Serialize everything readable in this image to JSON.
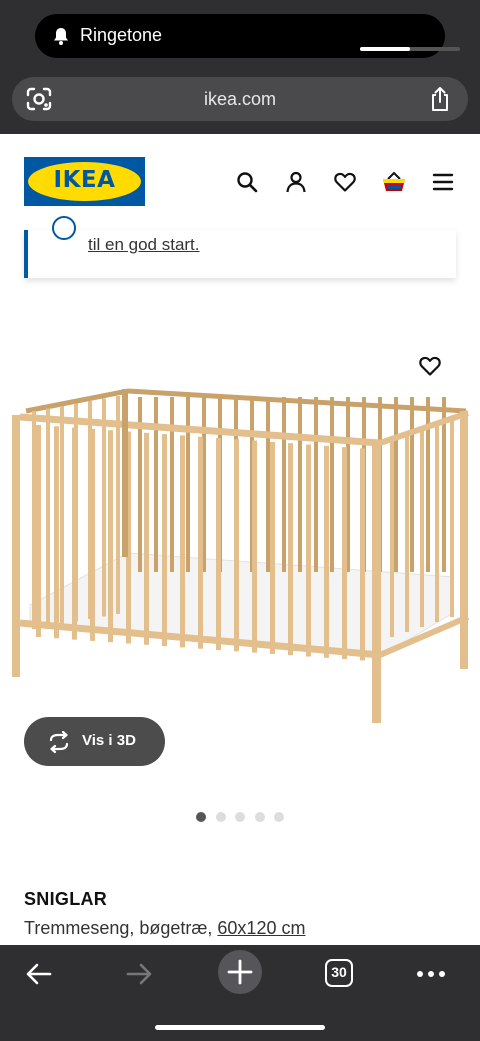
{
  "status": {
    "notification_label": "Ringetone",
    "volume_level": 0.5
  },
  "browser": {
    "url": "ikea.com",
    "tabs_count": "30"
  },
  "header": {
    "logo_text": "IKEA"
  },
  "promo": {
    "link_text": "til en god start."
  },
  "product": {
    "view_3d_label": "Vis i 3D",
    "name": "SNIGLAR",
    "description": "Tremmeseng, bøgetræ, ",
    "size": "60x120 cm",
    "carousel": {
      "total": 5,
      "active": 0
    }
  },
  "colors": {
    "ikea_blue": "#0058a3",
    "ikea_yellow": "#ffdb00",
    "chrome_dark": "#2f2f31",
    "wood": "#e2bf8d"
  }
}
